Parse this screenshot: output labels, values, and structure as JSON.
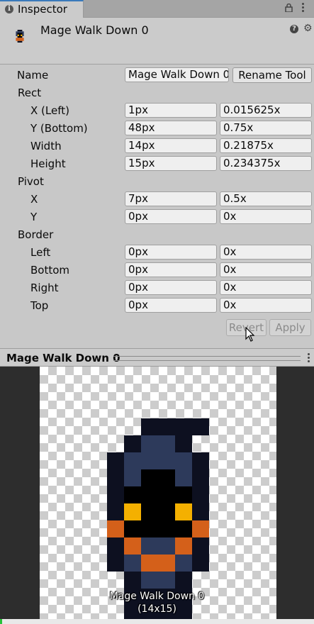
{
  "tab": {
    "label": "Inspector",
    "info_icon": "info-icon",
    "lock_icon": "lock-icon",
    "menu_icon": "kebab-menu-icon"
  },
  "header": {
    "title": "Mage Walk Down 0",
    "help_icon": "help-icon",
    "settings_icon": "gear-icon"
  },
  "name": {
    "label": "Name",
    "value": "Mage Walk Down 0",
    "button": "Rename Tool"
  },
  "rect": {
    "label": "Rect",
    "rows": [
      {
        "label": "X (Left)",
        "px": "1px",
        "norm": "0.015625x"
      },
      {
        "label": "Y (Bottom)",
        "px": "48px",
        "norm": "0.75x"
      },
      {
        "label": "Width",
        "px": "14px",
        "norm": "0.21875x"
      },
      {
        "label": "Height",
        "px": "15px",
        "norm": "0.234375x"
      }
    ]
  },
  "pivot": {
    "label": "Pivot",
    "rows": [
      {
        "label": "X",
        "px": "7px",
        "norm": "0.5x"
      },
      {
        "label": "Y",
        "px": "0px",
        "norm": "0x"
      }
    ]
  },
  "border": {
    "label": "Border",
    "rows": [
      {
        "label": "Left",
        "px": "0px",
        "norm": "0x"
      },
      {
        "label": "Bottom",
        "px": "0px",
        "norm": "0x"
      },
      {
        "label": "Right",
        "px": "0px",
        "norm": "0x"
      },
      {
        "label": "Top",
        "px": "0px",
        "norm": "0x"
      }
    ]
  },
  "actions": {
    "revert": "Revert",
    "apply": "Apply"
  },
  "preview": {
    "title": "Mage Walk Down 0",
    "caption_name": "Mage Walk Down 0",
    "caption_size": "(14x15)"
  },
  "colors": {
    "dark": "#0d1020",
    "navy": "#2d3a5b",
    "black": "#000000",
    "orange": "#d4601a",
    "yellow": "#f4b000"
  }
}
